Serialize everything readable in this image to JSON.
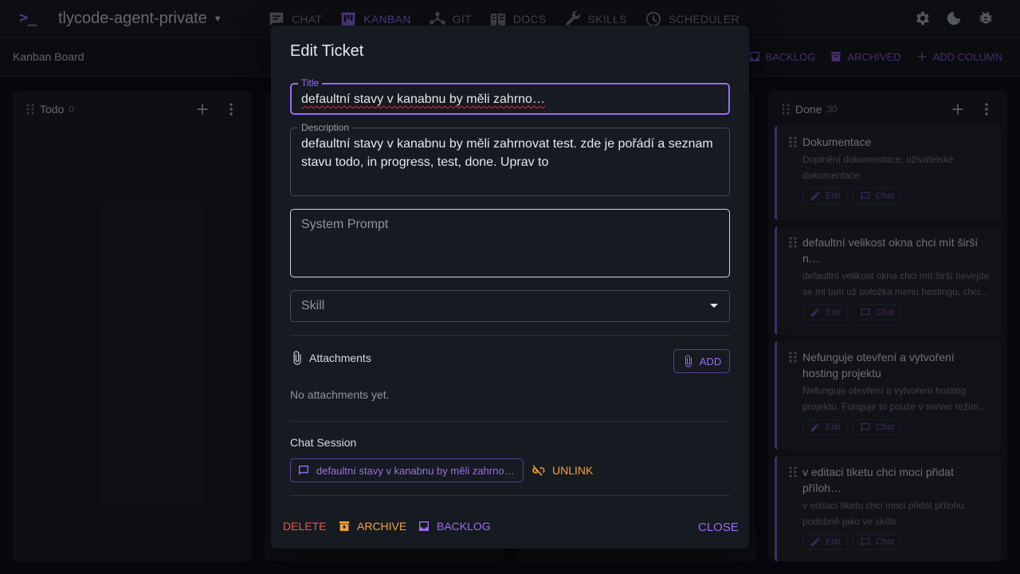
{
  "app": {
    "logo": ">_",
    "project": "tlycode-agent-private"
  },
  "nav": [
    {
      "label": "CHAT",
      "icon": "chat-icon"
    },
    {
      "label": "KANBAN",
      "icon": "kanban-icon",
      "active": true
    },
    {
      "label": "GIT",
      "icon": "git-icon"
    },
    {
      "label": "DOCS",
      "icon": "docs-icon"
    },
    {
      "label": "SKILLS",
      "icon": "wrench-icon"
    },
    {
      "label": "SCHEDULER",
      "icon": "clock-icon"
    }
  ],
  "top_actions": [
    "gear-icon",
    "moon-icon",
    "bug-icon"
  ],
  "subbar": {
    "title": "Kanban Board",
    "backlog": "BACKLOG",
    "archived": "ARCHIVED",
    "add_column": "ADD COLUMN"
  },
  "columns": {
    "todo": {
      "name": "Todo",
      "count": "0"
    },
    "done": {
      "name": "Done",
      "count": "30",
      "cards": [
        {
          "title": "Dokumentace",
          "desc": "Doplnění dokumentace, uživatelské dokumentace",
          "edit": "Edit",
          "chat": "Chat"
        },
        {
          "title": "defaultní velikost okna chci mít širší n…",
          "desc": "defaultní velikost okna chci mít širší nevejde se mi tam už položka menu hostingu, chci…",
          "edit": "Edit",
          "chat": "Chat"
        },
        {
          "title": "Nefunguje otevření a vytvoření hosting projektu",
          "desc": "Nefunguje otevření a vytvoření hosting projektu. Funguje to pouze v server režim…",
          "edit": "Edit",
          "chat": "Chat"
        },
        {
          "title": "v editaci tiketu chci moci přidat příloh…",
          "desc": "v editaci tiketu chci moci přidat přílohu podobně jako ve skills",
          "edit": "Edit",
          "chat": "Chat"
        }
      ]
    }
  },
  "dialog": {
    "title": "Edit Ticket",
    "title_label": "Title",
    "title_value": "defaultní stavy v kanabnu by měli zahrno…",
    "description_label": "Description",
    "description_value": "defaultní stavy v kanabnu by měli zahrnovat test. zde je pořádí a seznam stavu todo, in progress, test, done. Uprav to",
    "system_prompt_placeholder": "System Prompt",
    "skill_placeholder": "Skill",
    "attachments_label": "Attachments",
    "add_label": "ADD",
    "no_attachments": "No attachments yet.",
    "chat_session_label": "Chat Session",
    "chat_session_value": "defaultní stavy v kanabnu by měli zahrno…",
    "unlink_label": "UNLINK",
    "delete_label": "DELETE",
    "archive_label": "ARCHIVE",
    "backlog_label": "BACKLOG",
    "close_label": "CLOSE"
  },
  "colors": {
    "accent": "#9b6cf2",
    "warning": "#f2a33a",
    "danger": "#ef5350",
    "background": "#0d0f14"
  }
}
